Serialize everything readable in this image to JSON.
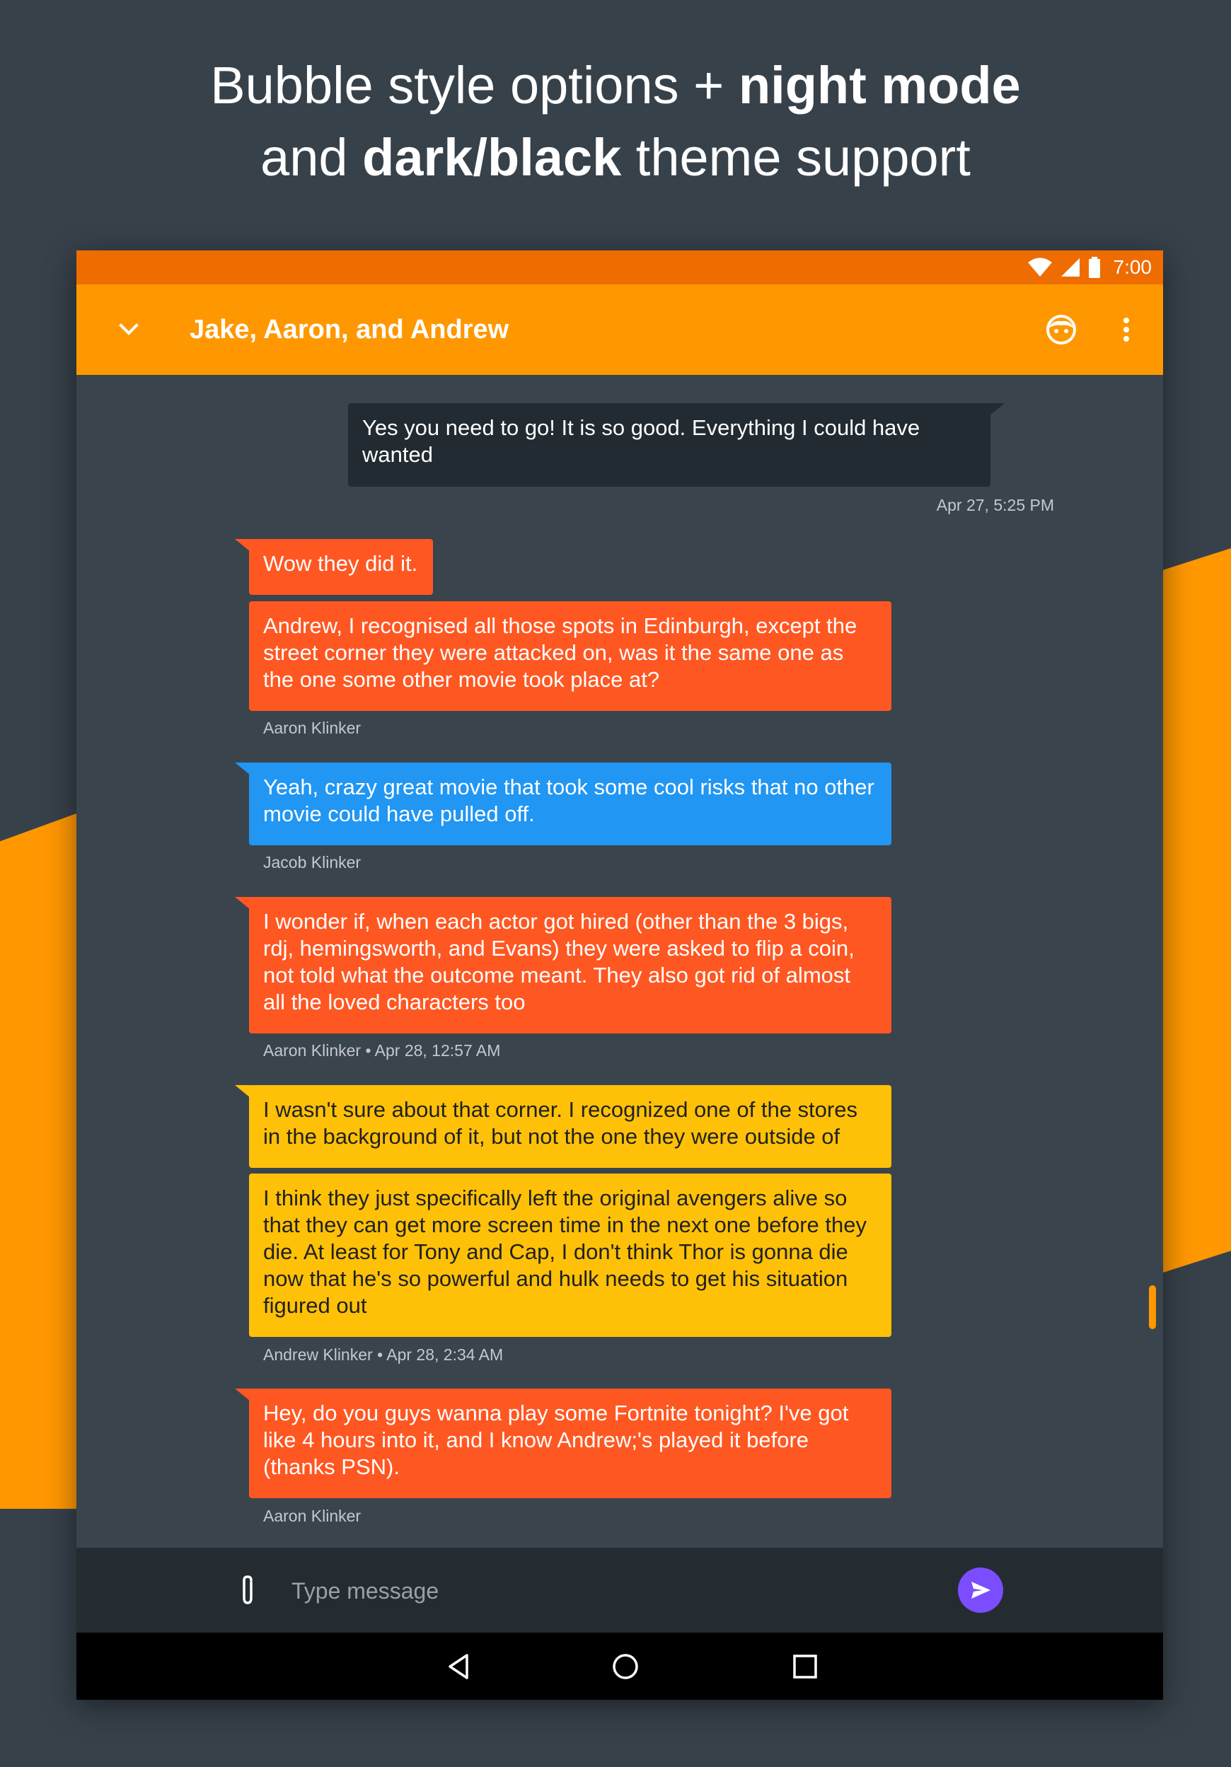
{
  "promo": {
    "line1_prefix": "Bubble style options + ",
    "line1_bold": "night mode",
    "line2_prefix": "and ",
    "line2_bold": "dark/black",
    "line2_suffix": " theme support"
  },
  "status_bar": {
    "time": "7:00",
    "icons": [
      "wifi-icon",
      "cell-signal-icon",
      "battery-icon"
    ]
  },
  "app_bar": {
    "title": "Jake, Aaron, and Andrew",
    "left_icon": "chevron-down-icon",
    "right_icons": [
      "emoji-icon",
      "more-vert-icon"
    ]
  },
  "messages": [
    {
      "text": "Yes you need to go! It is so good. Everything I could have wanted",
      "meta": "Apr 27, 5:25 PM"
    },
    {
      "text": "Wow they did it."
    },
    {
      "text": "Andrew, I recognised all those spots in Edinburgh, except the street corner they were attacked on, was it the same one as the one some other movie took place at?",
      "meta": "Aaron Klinker"
    },
    {
      "text": "Yeah, crazy great movie that took some cool risks that no other movie could have pulled off.",
      "meta": "Jacob Klinker"
    },
    {
      "text": "I wonder if, when each actor got hired (other than the 3 bigs, rdj, hemingsworth, and Evans) they were asked to flip a coin, not told what the outcome meant. They also got rid of almost all the loved characters too",
      "meta": "Aaron Klinker • Apr 28, 12:57 AM"
    },
    {
      "text": "I wasn't sure about that corner. I recognized one of the stores in the background of it, but not the one they were outside of"
    },
    {
      "text": "I think they just specifically left the original avengers alive so that they can get more screen time in the next one before they die. At least for Tony and Cap, I don't think Thor is gonna die now that he's so powerful and hulk needs to get his situation figured out",
      "meta": "Andrew Klinker • Apr 28, 2:34 AM"
    },
    {
      "text": "Hey, do you guys wanna play some Fortnite tonight? I've got like 4 hours into it, and I know Andrew;'s played it before (thanks PSN).",
      "meta": "Aaron Klinker"
    }
  ],
  "composer": {
    "placeholder": "Type message",
    "attach_icon": "paperclip-icon",
    "send_icon": "send-icon"
  },
  "nav_bar": {
    "icons": [
      "back-icon",
      "home-icon",
      "recents-icon"
    ]
  },
  "colors": {
    "background": "#37414a",
    "accent": "#ff9800",
    "status_bar": "#ef6c00",
    "outgoing_bubble": "#222b31",
    "aaron_bubble": "#ff5722",
    "jacob_bubble": "#2196f3",
    "andrew_bubble": "#ffc107",
    "send_button": "#7c4dff"
  }
}
